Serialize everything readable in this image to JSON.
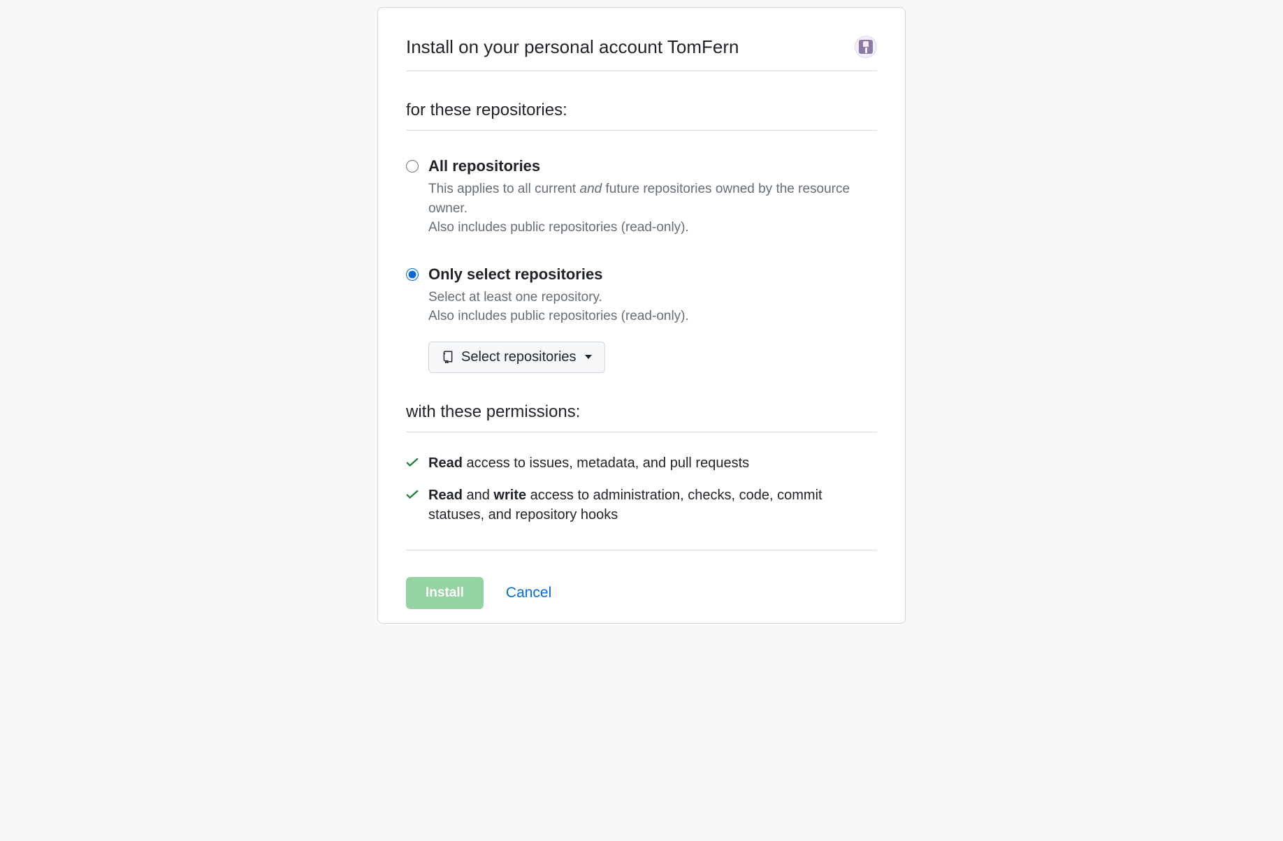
{
  "header": {
    "title": "Install on your personal account TomFern"
  },
  "sections": {
    "repos_heading": "for these repositories:",
    "perms_heading": "with these permissions:"
  },
  "radio": {
    "all": {
      "label": "All repositories",
      "desc_pre": "This applies to all current ",
      "desc_em": "and",
      "desc_post": " future repositories owned by the resource owner.",
      "desc_line2": "Also includes public repositories (read-only)."
    },
    "select": {
      "label": "Only select repositories",
      "desc_line1": "Select at least one repository.",
      "desc_line2": "Also includes public repositories (read-only).",
      "button": "Select repositories"
    }
  },
  "permissions": [
    {
      "strong1": "Read",
      "mid": " access to issues, metadata, and pull requests",
      "strong2": "",
      "tail": ""
    },
    {
      "strong1": "Read",
      "mid": " and ",
      "strong2": "write",
      "tail": " access to administration, checks, code, commit statuses, and repository hooks"
    }
  ],
  "footer": {
    "install": "Install",
    "cancel": "Cancel"
  }
}
